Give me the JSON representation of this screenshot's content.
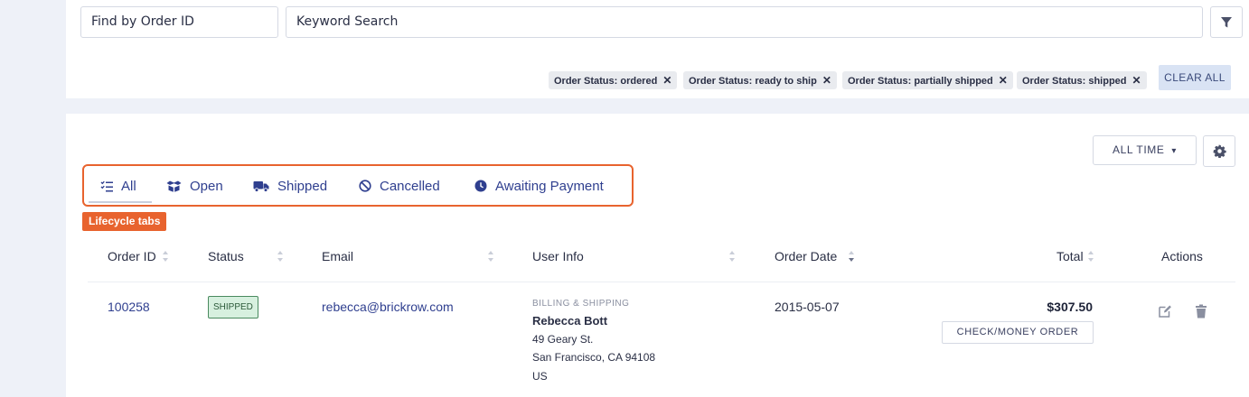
{
  "search": {
    "order_id_placeholder": "Find by Order ID",
    "keyword_placeholder": "Keyword Search"
  },
  "filters": {
    "chips": [
      {
        "label": "Order Status: ordered"
      },
      {
        "label": "Order Status: ready to ship"
      },
      {
        "label": "Order Status: partially shipped"
      },
      {
        "label": "Order Status: shipped"
      }
    ],
    "remove_glyph": "✕",
    "clear_all_label": "CLEAR ALL"
  },
  "toolbar": {
    "time_range_label": "ALL TIME",
    "time_range_caret": "▾"
  },
  "tabs": [
    {
      "label": "All",
      "icon": "list-check-icon",
      "active": true
    },
    {
      "label": "Open",
      "icon": "open-box-icon"
    },
    {
      "label": "Shipped",
      "icon": "truck-icon"
    },
    {
      "label": "Cancelled",
      "icon": "ban-icon"
    },
    {
      "label": "Awaiting Payment",
      "icon": "clock-icon"
    }
  ],
  "annotation": {
    "label": "Lifecycle tabs",
    "color": "#e8632e"
  },
  "table": {
    "columns": [
      "Order ID",
      "Status",
      "Email",
      "User Info",
      "Order Date",
      "Total",
      "Actions"
    ],
    "rows": [
      {
        "order_id": "100258",
        "status": "SHIPPED",
        "email": "rebecca@brickrow.com",
        "user_info": {
          "caption": "BILLING & SHIPPING",
          "name": "Rebecca Bott",
          "street": "49 Geary St.",
          "city_line": "San Francisco, CA 94108",
          "country": "US"
        },
        "order_date": "2015-05-07",
        "total": "$307.50",
        "payment_method": "CHECK/MONEY ORDER",
        "actions": [
          "edit-icon",
          "trash-icon"
        ]
      }
    ]
  },
  "colors": {
    "accent": "#2f3f8f",
    "status_shipped_bg": "#d7f0df",
    "annotation": "#e8632e"
  }
}
